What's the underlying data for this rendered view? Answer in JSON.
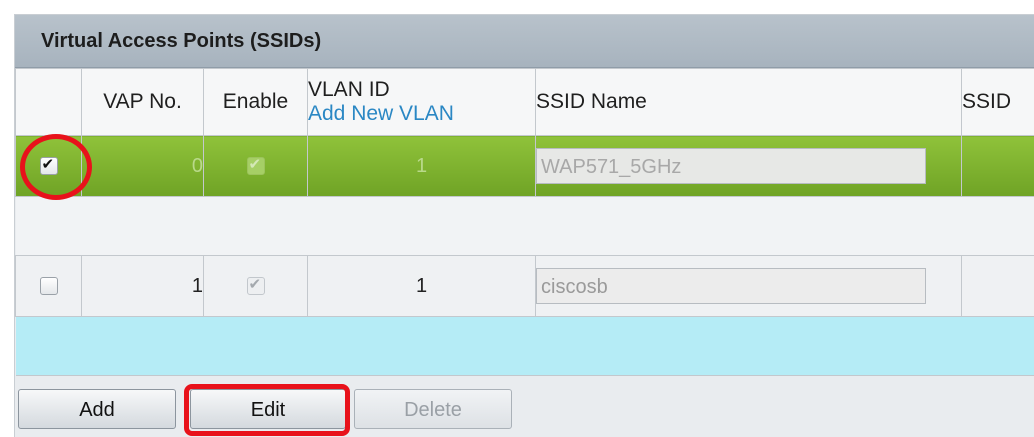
{
  "panel": {
    "title": "Virtual Access Points (SSIDs)"
  },
  "columns": {
    "vap_no": "VAP No.",
    "enable": "Enable",
    "vlan_id": "VLAN ID",
    "add_new_vlan": "Add New VLAN",
    "ssid_name": "SSID Name",
    "ssid_cut": "SSID"
  },
  "rows": [
    {
      "selected": true,
      "vap_no": "0",
      "enabled": true,
      "vlan_id": "1",
      "ssid_name": "WAP571_5GHz"
    },
    {
      "selected": false,
      "vap_no": "1",
      "enabled": true,
      "vlan_id": "1",
      "ssid_name": "ciscosb"
    }
  ],
  "buttons": {
    "add": "Add",
    "edit": "Edit",
    "delete": "Delete"
  },
  "colors": {
    "selected_row": "#7cb32e",
    "highlight_ring": "#e8121b",
    "link": "#2a87c4",
    "new_row": "#b5ecf6"
  }
}
